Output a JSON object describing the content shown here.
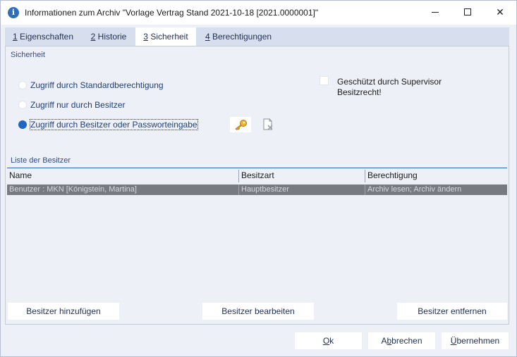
{
  "window": {
    "title": "Informationen zum Archiv \"Vorlage Vertrag Stand 2021-10-18 [2021.0000001]\"",
    "icon": "info-icon",
    "controls": {
      "minimize": "minimize-icon",
      "maximize": "maximize-icon",
      "close": "✕"
    }
  },
  "tabs": [
    {
      "key": "1",
      "rest": " Eigenschaften",
      "active": false
    },
    {
      "key": "2",
      "rest": " Historie",
      "active": false
    },
    {
      "key": "3",
      "rest": " Sicherheit",
      "active": true
    },
    {
      "key": "4",
      "rest": " Berechtigungen",
      "active": false
    }
  ],
  "security": {
    "section_label": "Sicherheit",
    "options": [
      {
        "label": "Zugriff durch Standardberechtigung",
        "checked": false
      },
      {
        "label": "Zugriff nur durch Besitzer",
        "checked": false
      },
      {
        "label": "Zugriff durch Besitzer oder Passworteingabe",
        "checked": true
      }
    ],
    "supervisor_checkbox": {
      "label": "Geschützt durch Supervisor Besitzrecht!",
      "checked": false
    },
    "key_icon": "key-icon",
    "delete_password_icon": "document-delete-icon"
  },
  "owners": {
    "section_label": "Liste der Besitzer",
    "columns": [
      "Name",
      "Besitzart",
      "Berechtigung"
    ],
    "rows": [
      [
        "Benutzer : MKN [Königstein, Martina]",
        "Hauptbesitzer",
        "Archiv lesen; Archiv ändern"
      ]
    ],
    "buttons": {
      "add": "Besitzer hinzufügen",
      "edit": "Besitzer bearbeiten",
      "remove": "Besitzer entfernen"
    }
  },
  "footer": {
    "ok": {
      "key": "O",
      "rest": "k"
    },
    "cancel": {
      "pre": "A",
      "key": "b",
      "rest": "brechen"
    },
    "apply": {
      "key": "Ü",
      "rest": "bernehmen"
    }
  },
  "colors": {
    "accent": "#1f65c4",
    "selected_row": "#777a80",
    "tab_strip": "#d7dfee",
    "background": "#eef0f7"
  }
}
